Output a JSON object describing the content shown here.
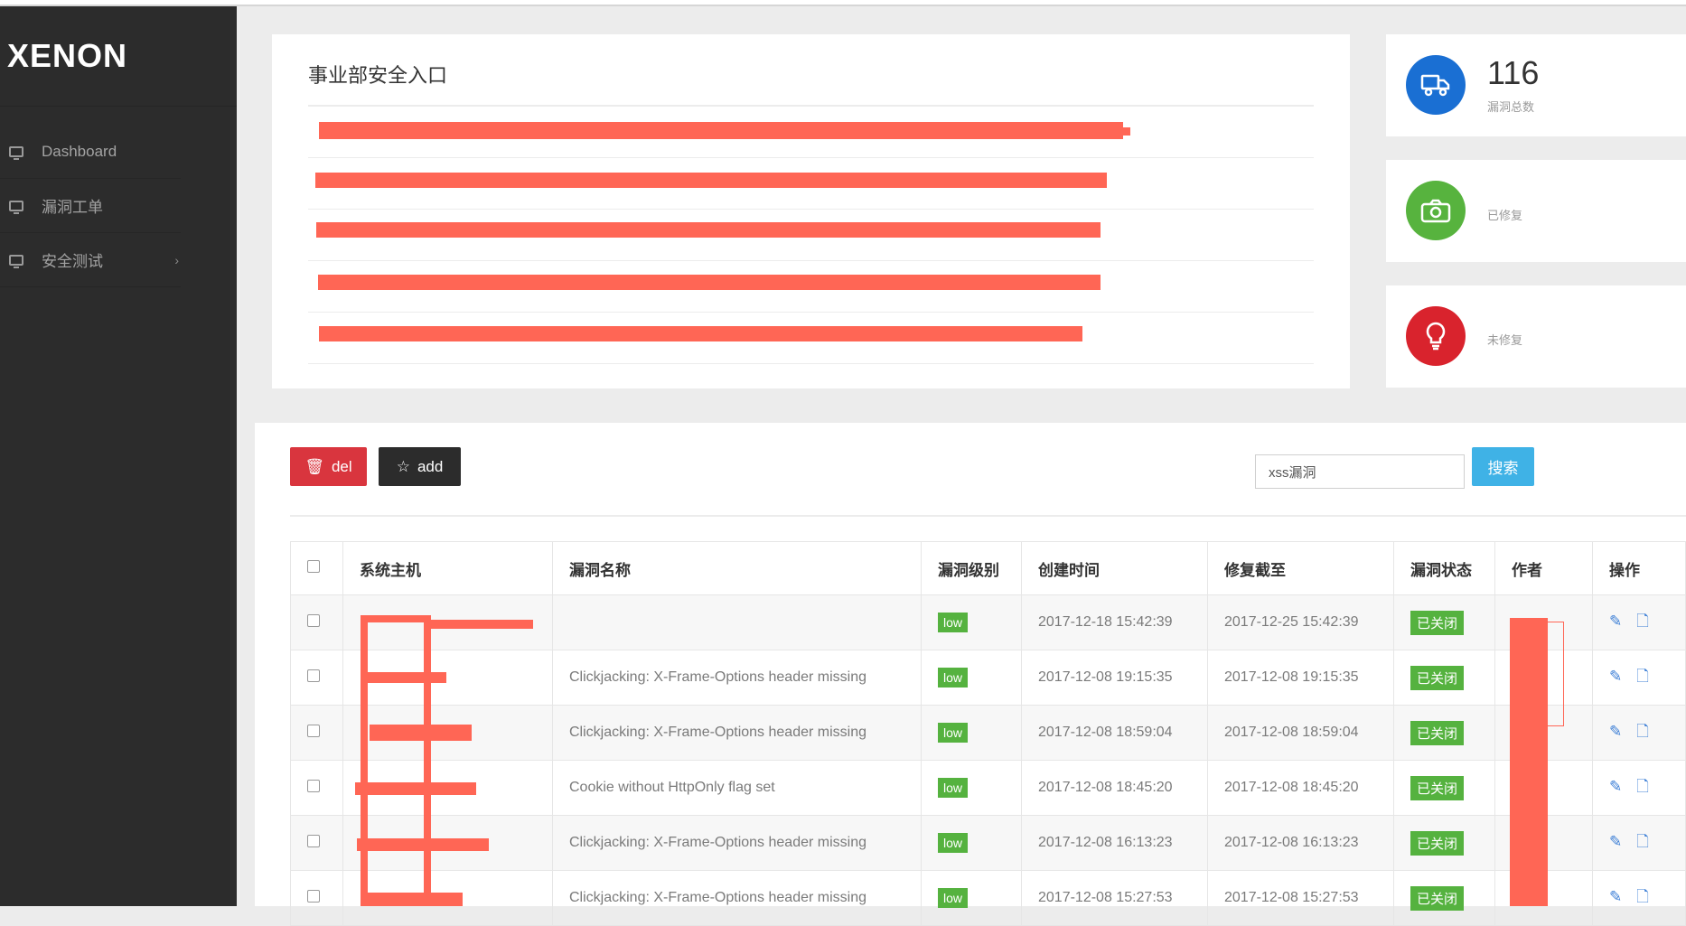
{
  "app": {
    "logo": "XENON"
  },
  "sidebar": {
    "items": [
      {
        "label": "Dashboard",
        "icon": "monitor-icon"
      },
      {
        "label": "漏洞工单",
        "icon": "monitor-icon"
      },
      {
        "label": "安全测试",
        "icon": "monitor-icon",
        "caret": "›"
      }
    ]
  },
  "entry_panel": {
    "title": "事业部安全入口",
    "rows_redacted": 5
  },
  "stats": [
    {
      "value": "116",
      "label": "漏洞总数",
      "icon": "truck-icon",
      "color": "#1a73d9"
    },
    {
      "value": "",
      "label": "已修复",
      "icon": "camera-icon",
      "color": "#57b33e"
    },
    {
      "value": "",
      "label": "未修复",
      "icon": "lightbulb-icon",
      "color": "#d9232d"
    }
  ],
  "toolbar": {
    "del_label": "del",
    "add_label": "add",
    "search_value": "xss漏洞",
    "search_button": "搜索"
  },
  "table": {
    "columns": [
      "系统主机",
      "漏洞名称",
      "漏洞级别",
      "创建时间",
      "修复截至",
      "漏洞状态",
      "作者",
      "操作"
    ],
    "rows": [
      {
        "host": "",
        "name": "",
        "level": "low",
        "created": "2017-12-18 15:42:39",
        "deadline": "2017-12-25 15:42:39",
        "status": "已关闭",
        "author": ""
      },
      {
        "host": "",
        "name": "Clickjacking: X-Frame-Options header missing",
        "level": "low",
        "created": "2017-12-08 19:15:35",
        "deadline": "2017-12-08 19:15:35",
        "status": "已关闭",
        "author": ""
      },
      {
        "host": "",
        "name": "Clickjacking: X-Frame-Options header missing",
        "level": "low",
        "created": "2017-12-08 18:59:04",
        "deadline": "2017-12-08 18:59:04",
        "status": "已关闭",
        "author": ""
      },
      {
        "host": "",
        "name": "Cookie without HttpOnly flag set",
        "level": "low",
        "created": "2017-12-08 18:45:20",
        "deadline": "2017-12-08 18:45:20",
        "status": "已关闭",
        "author": ""
      },
      {
        "host": "",
        "name": "Clickjacking: X-Frame-Options header missing",
        "level": "low",
        "created": "2017-12-08 16:13:23",
        "deadline": "2017-12-08 16:13:23",
        "status": "已关闭",
        "author": ""
      },
      {
        "host": "",
        "name": "Clickjacking: X-Frame-Options header missing",
        "level": "low",
        "created": "2017-12-08 15:27:53",
        "deadline": "2017-12-08 15:27:53",
        "status": "已关闭",
        "author": ""
      }
    ]
  }
}
